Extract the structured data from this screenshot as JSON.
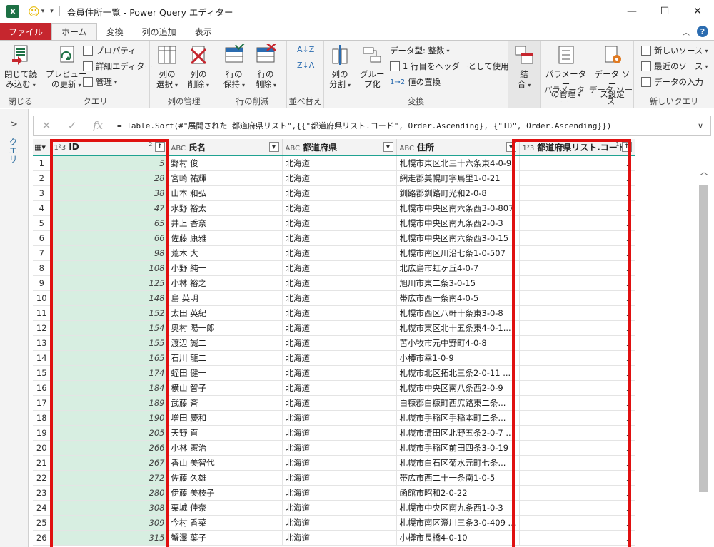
{
  "window": {
    "title": "会員住所一覧 - Power Query エディター",
    "logo": "X",
    "min": "—",
    "max": "☐",
    "close": "✕"
  },
  "tabs": [
    "ファイル",
    "ホーム",
    "変換",
    "列の追加",
    "表示"
  ],
  "ribbon": {
    "close_group": {
      "btn1": "閉じて読",
      "btn1b": "み込む",
      "label": "閉じる"
    },
    "query_group": {
      "preview": "プレビュー",
      "preview_b": "の更新",
      "properties": "プロパティ",
      "advanced": "詳細エディター",
      "manage": "管理",
      "label": "クエリ"
    },
    "cols_group": {
      "select": "列の",
      "select_b": "選択",
      "remove": "列の",
      "remove_b": "削除",
      "label": "列の管理"
    },
    "rows_group": {
      "keep": "行の",
      "keep_b": "保持",
      "remove": "行の",
      "remove_b": "削除",
      "label": "行の削減"
    },
    "sort_group": {
      "label": "並べ替え"
    },
    "transform_group": {
      "split": "列の",
      "split_b": "分割",
      "group": "グルー",
      "group_b": "プ化",
      "datatype": "データ型: 整数",
      "header": "1 行目をヘッダーとして使用",
      "replace": "値の置換",
      "label": "変換"
    },
    "combine_group": {
      "combine": "結",
      "combine_b": "合"
    },
    "param_group": {
      "manage": "パラメーター",
      "manage_b": "の管理",
      "label": "パラメーター"
    },
    "ds_group": {
      "settings": "データ ソー",
      "settings_b": "ス設定",
      "label": "データ ソース"
    },
    "newq_group": {
      "new_source": "新しいソース",
      "recent": "最近のソース",
      "enter": "データの入力",
      "label": "新しいクエリ"
    }
  },
  "leftpane": {
    "label": "クエリ"
  },
  "formula": "= Table.Sort(#\"展開された 都道府県リスト\",{{\"都道府県リスト.コード\", Order.Ascending}, {\"ID\", Order.Ascending}})",
  "columns": [
    {
      "type": "1²3",
      "name": "ID",
      "sort": "2"
    },
    {
      "type": "ABC",
      "name": "氏名"
    },
    {
      "type": "ABC",
      "name": "都道府県"
    },
    {
      "type": "ABC",
      "name": "住所"
    },
    {
      "type": "1²3",
      "name": "都道府県リスト.コード",
      "sort": "1"
    }
  ],
  "rows": [
    [
      "1",
      "5",
      "野村 俊一",
      "北海道",
      "札幌市東区北三十六条東4-0-9",
      "1"
    ],
    [
      "2",
      "28",
      "宮崎 祐輝",
      "北海道",
      "網走郡美幌町字鳥里1-0-21",
      "1"
    ],
    [
      "3",
      "38",
      "山本 和弘",
      "北海道",
      "釧路郡釧路町光和2-0-8",
      "1"
    ],
    [
      "4",
      "47",
      "水野 裕太",
      "北海道",
      "札幌市中央区南六条西3-0-807",
      "1"
    ],
    [
      "5",
      "65",
      "井上 香奈",
      "北海道",
      "札幌市中央区南九条西2-0-3",
      "1"
    ],
    [
      "6",
      "66",
      "佐藤 康雅",
      "北海道",
      "札幌市中央区南六条西3-0-15",
      "1"
    ],
    [
      "7",
      "98",
      "荒木 大",
      "北海道",
      "札幌市南区川沿七条1-0-507",
      "1"
    ],
    [
      "8",
      "108",
      "小野 純一",
      "北海道",
      "北広島市虹ヶ丘4-0-7",
      "1"
    ],
    [
      "9",
      "125",
      "小林 裕之",
      "北海道",
      "旭川市東二条3-0-15",
      "1"
    ],
    [
      "10",
      "148",
      "島 英明",
      "北海道",
      "帯広市西一条南4-0-5",
      "1"
    ],
    [
      "11",
      "152",
      "太田 英紀",
      "北海道",
      "札幌市西区八軒十条東3-0-8",
      "1"
    ],
    [
      "12",
      "154",
      "奥村 陽一郎",
      "北海道",
      "札幌市東区北十五条東4-0-1...",
      "1"
    ],
    [
      "13",
      "155",
      "渡辺 誠二",
      "北海道",
      "苫小牧市元中野町4-0-8",
      "1"
    ],
    [
      "14",
      "165",
      "石川 龍二",
      "北海道",
      "小樽市幸1-0-9",
      "1"
    ],
    [
      "15",
      "174",
      "蛭田 健一",
      "北海道",
      "札幌市北区拓北三条2-0-11 ...",
      "1"
    ],
    [
      "16",
      "184",
      "横山 智子",
      "北海道",
      "札幌市中央区南八条西2-0-9",
      "1"
    ],
    [
      "17",
      "189",
      "武藤 斉",
      "北海道",
      "白糠郡白糠町西庶路東二条...",
      "1"
    ],
    [
      "18",
      "190",
      "増田 慶和",
      "北海道",
      "札幌市手稲区手稲本町二条...",
      "1"
    ],
    [
      "19",
      "205",
      "天野 直",
      "北海道",
      "札幌市清田区北野五条2-0-7 ...",
      "1"
    ],
    [
      "20",
      "266",
      "小林 憲治",
      "北海道",
      "札幌市手稲区前田四条3-0-19",
      "1"
    ],
    [
      "21",
      "267",
      "香山 美智代",
      "北海道",
      "札幌市白石区菊水元町七条...",
      "1"
    ],
    [
      "22",
      "272",
      "佐藤 久雄",
      "北海道",
      "帯広市西二十一条南1-0-5",
      "1"
    ],
    [
      "23",
      "280",
      "伊藤 美枝子",
      "北海道",
      "函館市昭和2-0-22",
      "1"
    ],
    [
      "24",
      "308",
      "栗城 佳奈",
      "北海道",
      "札幌市中央区南九条西1-0-3",
      "1"
    ],
    [
      "25",
      "309",
      "今村 香菜",
      "北海道",
      "札幌市南区澄川三条3-0-409 ...",
      "1"
    ],
    [
      "26",
      "315",
      "蟹澤 葉子",
      "北海道",
      "小樽市長橋4-0-10",
      "1"
    ]
  ],
  "colors": {
    "file_tab": "#c6262e",
    "highlight": "#e01010",
    "id_fill": "#d7eee1",
    "header_underline": "#1fa291"
  }
}
